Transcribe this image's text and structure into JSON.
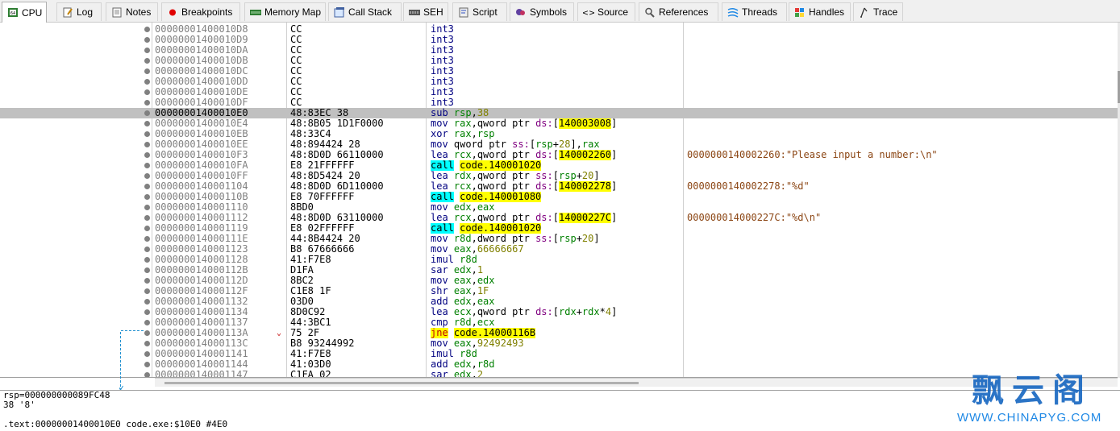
{
  "tabs": [
    {
      "label": "CPU",
      "icon": "cpu-icon"
    },
    {
      "label": "Log",
      "icon": "log-icon"
    },
    {
      "label": "Notes",
      "icon": "notes-icon"
    },
    {
      "label": "Breakpoints",
      "icon": "breakpoint-icon"
    },
    {
      "label": "Memory Map",
      "icon": "memory-map-icon"
    },
    {
      "label": "Call Stack",
      "icon": "call-stack-icon"
    },
    {
      "label": "SEH",
      "icon": "seh-icon"
    },
    {
      "label": "Script",
      "icon": "script-icon"
    },
    {
      "label": "Symbols",
      "icon": "symbols-icon"
    },
    {
      "label": "Source",
      "icon": "source-icon"
    },
    {
      "label": "References",
      "icon": "references-icon"
    },
    {
      "label": "Threads",
      "icon": "threads-icon"
    },
    {
      "label": "Handles",
      "icon": "handles-icon"
    },
    {
      "label": "Trace",
      "icon": "trace-icon"
    }
  ],
  "active_tab": "CPU",
  "disasm": {
    "selected_address": "00000001400010E0",
    "rows": [
      {
        "addr": "00000001400010D8",
        "bytes": "CC",
        "instr": [
          [
            "k",
            "int3"
          ]
        ],
        "comment": ""
      },
      {
        "addr": "00000001400010D9",
        "bytes": "CC",
        "instr": [
          [
            "k",
            "int3"
          ]
        ],
        "comment": ""
      },
      {
        "addr": "00000001400010DA",
        "bytes": "CC",
        "instr": [
          [
            "k",
            "int3"
          ]
        ],
        "comment": ""
      },
      {
        "addr": "00000001400010DB",
        "bytes": "CC",
        "instr": [
          [
            "k",
            "int3"
          ]
        ],
        "comment": ""
      },
      {
        "addr": "00000001400010DC",
        "bytes": "CC",
        "instr": [
          [
            "k",
            "int3"
          ]
        ],
        "comment": ""
      },
      {
        "addr": "00000001400010DD",
        "bytes": "CC",
        "instr": [
          [
            "k",
            "int3"
          ]
        ],
        "comment": ""
      },
      {
        "addr": "00000001400010DE",
        "bytes": "CC",
        "instr": [
          [
            "k",
            "int3"
          ]
        ],
        "comment": ""
      },
      {
        "addr": "00000001400010DF",
        "bytes": "CC",
        "instr": [
          [
            "k",
            "int3"
          ]
        ],
        "comment": ""
      },
      {
        "addr": "00000001400010E0",
        "bytes": "48:83EC 38",
        "instr": [
          [
            "k",
            "sub "
          ],
          [
            "reg",
            "rsp"
          ],
          [
            "pt",
            ","
          ],
          [
            "num",
            "38"
          ]
        ],
        "comment": ""
      },
      {
        "addr": "00000001400010E4",
        "bytes": "48:8B05 1D1F0000",
        "instr": [
          [
            "k",
            "mov "
          ],
          [
            "reg",
            "rax"
          ],
          [
            "pt",
            ",qword ptr "
          ],
          [
            "seg",
            "ds:"
          ],
          [
            "pt",
            "["
          ],
          [
            "hl",
            "140003008"
          ],
          [
            "pt",
            "]"
          ]
        ],
        "comment": ""
      },
      {
        "addr": "00000001400010EB",
        "bytes": "48:33C4",
        "instr": [
          [
            "k",
            "xor "
          ],
          [
            "reg",
            "rax"
          ],
          [
            "pt",
            ","
          ],
          [
            "reg",
            "rsp"
          ]
        ],
        "comment": ""
      },
      {
        "addr": "00000001400010EE",
        "bytes": "48:894424 28",
        "instr": [
          [
            "k",
            "mov "
          ],
          [
            "pt",
            "qword ptr "
          ],
          [
            "seg",
            "ss:"
          ],
          [
            "pt",
            "["
          ],
          [
            "reg",
            "rsp"
          ],
          [
            "pt",
            "+"
          ],
          [
            "num",
            "28"
          ],
          [
            "pt",
            "],"
          ],
          [
            "reg",
            "rax"
          ]
        ],
        "comment": ""
      },
      {
        "addr": "00000001400010F3",
        "bytes": "48:8D0D 66110000",
        "instr": [
          [
            "k",
            "lea "
          ],
          [
            "reg",
            "rcx"
          ],
          [
            "pt",
            ",qword ptr "
          ],
          [
            "seg",
            "ds:"
          ],
          [
            "pt",
            "["
          ],
          [
            "hl",
            "140002260"
          ],
          [
            "pt",
            "]"
          ]
        ],
        "comment": "0000000140002260:\"Please input a number:\\n\""
      },
      {
        "addr": "00000001400010FA",
        "bytes": "E8 21FFFFFF",
        "instr": [
          [
            "call",
            "call"
          ],
          [
            "pt",
            " "
          ],
          [
            "tgt",
            "code.140001020"
          ]
        ],
        "comment": ""
      },
      {
        "addr": "00000001400010FF",
        "bytes": "48:8D5424 20",
        "instr": [
          [
            "k",
            "lea "
          ],
          [
            "reg",
            "rdx"
          ],
          [
            "pt",
            ",qword ptr "
          ],
          [
            "seg",
            "ss:"
          ],
          [
            "pt",
            "["
          ],
          [
            "reg",
            "rsp"
          ],
          [
            "pt",
            "+"
          ],
          [
            "num",
            "20"
          ],
          [
            "pt",
            "]"
          ]
        ],
        "comment": ""
      },
      {
        "addr": "0000000140001104",
        "bytes": "48:8D0D 6D110000",
        "instr": [
          [
            "k",
            "lea "
          ],
          [
            "reg",
            "rcx"
          ],
          [
            "pt",
            ",qword ptr "
          ],
          [
            "seg",
            "ds:"
          ],
          [
            "pt",
            "["
          ],
          [
            "hl",
            "140002278"
          ],
          [
            "pt",
            "]"
          ]
        ],
        "comment": "0000000140002278:\"%d\""
      },
      {
        "addr": "000000014000110B",
        "bytes": "E8 70FFFFFF",
        "instr": [
          [
            "call",
            "call"
          ],
          [
            "pt",
            " "
          ],
          [
            "tgt",
            "code.140001080"
          ]
        ],
        "comment": ""
      },
      {
        "addr": "0000000140001110",
        "bytes": "8BD0",
        "instr": [
          [
            "k",
            "mov "
          ],
          [
            "reg",
            "edx"
          ],
          [
            "pt",
            ","
          ],
          [
            "reg",
            "eax"
          ]
        ],
        "comment": ""
      },
      {
        "addr": "0000000140001112",
        "bytes": "48:8D0D 63110000",
        "instr": [
          [
            "k",
            "lea "
          ],
          [
            "reg",
            "rcx"
          ],
          [
            "pt",
            ",qword ptr "
          ],
          [
            "seg",
            "ds:"
          ],
          [
            "pt",
            "["
          ],
          [
            "hl",
            "14000227C"
          ],
          [
            "pt",
            "]"
          ]
        ],
        "comment": "000000014000227C:\"%d\\n\""
      },
      {
        "addr": "0000000140001119",
        "bytes": "E8 02FFFFFF",
        "instr": [
          [
            "call",
            "call"
          ],
          [
            "pt",
            " "
          ],
          [
            "tgt",
            "code.140001020"
          ]
        ],
        "comment": ""
      },
      {
        "addr": "000000014000111E",
        "bytes": "44:8B4424 20",
        "instr": [
          [
            "k",
            "mov "
          ],
          [
            "reg",
            "r8d"
          ],
          [
            "pt",
            ",dword ptr "
          ],
          [
            "seg",
            "ss:"
          ],
          [
            "pt",
            "["
          ],
          [
            "reg",
            "rsp"
          ],
          [
            "pt",
            "+"
          ],
          [
            "num",
            "20"
          ],
          [
            "pt",
            "]"
          ]
        ],
        "comment": ""
      },
      {
        "addr": "0000000140001123",
        "bytes": "B8 67666666",
        "instr": [
          [
            "k",
            "mov "
          ],
          [
            "reg",
            "eax"
          ],
          [
            "pt",
            ","
          ],
          [
            "num",
            "66666667"
          ]
        ],
        "comment": ""
      },
      {
        "addr": "0000000140001128",
        "bytes": "41:F7E8",
        "instr": [
          [
            "k",
            "imul "
          ],
          [
            "reg",
            "r8d"
          ]
        ],
        "comment": ""
      },
      {
        "addr": "000000014000112B",
        "bytes": "D1FA",
        "instr": [
          [
            "k",
            "sar "
          ],
          [
            "reg",
            "edx"
          ],
          [
            "pt",
            ","
          ],
          [
            "num",
            "1"
          ]
        ],
        "comment": ""
      },
      {
        "addr": "000000014000112D",
        "bytes": "8BC2",
        "instr": [
          [
            "k",
            "mov "
          ],
          [
            "reg",
            "eax"
          ],
          [
            "pt",
            ","
          ],
          [
            "reg",
            "edx"
          ]
        ],
        "comment": ""
      },
      {
        "addr": "000000014000112F",
        "bytes": "C1E8 1F",
        "instr": [
          [
            "k",
            "shr "
          ],
          [
            "reg",
            "eax"
          ],
          [
            "pt",
            ","
          ],
          [
            "num",
            "1F"
          ]
        ],
        "comment": ""
      },
      {
        "addr": "0000000140001132",
        "bytes": "03D0",
        "instr": [
          [
            "k",
            "add "
          ],
          [
            "reg",
            "edx"
          ],
          [
            "pt",
            ","
          ],
          [
            "reg",
            "eax"
          ]
        ],
        "comment": ""
      },
      {
        "addr": "0000000140001134",
        "bytes": "8D0C92",
        "instr": [
          [
            "k",
            "lea "
          ],
          [
            "reg",
            "ecx"
          ],
          [
            "pt",
            ",qword ptr "
          ],
          [
            "seg",
            "ds:"
          ],
          [
            "pt",
            "["
          ],
          [
            "reg",
            "rdx"
          ],
          [
            "pt",
            "+"
          ],
          [
            "reg",
            "rdx"
          ],
          [
            "pt",
            "*"
          ],
          [
            "num",
            "4"
          ],
          [
            "pt",
            "]"
          ]
        ],
        "comment": ""
      },
      {
        "addr": "0000000140001137",
        "bytes": "44:3BC1",
        "instr": [
          [
            "k",
            "cmp "
          ],
          [
            "reg",
            "r8d"
          ],
          [
            "pt",
            ","
          ],
          [
            "reg",
            "ecx"
          ]
        ],
        "comment": ""
      },
      {
        "addr": "000000014000113A",
        "bytes": "75 2F",
        "instr": [
          [
            "jmp",
            "jne"
          ],
          [
            "pt",
            " "
          ],
          [
            "tgt",
            "code.14000116B"
          ]
        ],
        "comment": "",
        "arrow": "⌄"
      },
      {
        "addr": "000000014000113C",
        "bytes": "B8 93244992",
        "instr": [
          [
            "k",
            "mov "
          ],
          [
            "reg",
            "eax"
          ],
          [
            "pt",
            ","
          ],
          [
            "num",
            "92492493"
          ]
        ],
        "comment": ""
      },
      {
        "addr": "0000000140001141",
        "bytes": "41:F7E8",
        "instr": [
          [
            "k",
            "imul "
          ],
          [
            "reg",
            "r8d"
          ]
        ],
        "comment": ""
      },
      {
        "addr": "0000000140001144",
        "bytes": "41:03D0",
        "instr": [
          [
            "k",
            "add "
          ],
          [
            "reg",
            "edx"
          ],
          [
            "pt",
            ","
          ],
          [
            "reg",
            "r8d"
          ]
        ],
        "comment": ""
      },
      {
        "addr": "0000000140001147",
        "bytes": "C1FA 02",
        "instr": [
          [
            "k",
            "sar "
          ],
          [
            "reg",
            "edx"
          ],
          [
            "pt",
            ","
          ],
          [
            "num",
            "2"
          ]
        ],
        "comment": ""
      }
    ]
  },
  "info": {
    "line1": "rsp=000000000089FC48",
    "line2": "38 '8'",
    "line3": "",
    "line4": ".text:00000001400010E0 code.exe:$10E0 #4E0"
  },
  "watermark": {
    "cn": "飘云阁",
    "url": "WWW.CHINAPYG.COM"
  },
  "colors": {
    "selected_row": "#c0c0c0",
    "call_highlight": "#00ffff",
    "jump_highlight": "#ffff00",
    "address_highlight": "#ffff00",
    "comment": "#8b4513",
    "register": "#008000",
    "number": "#808000",
    "segment": "#800080",
    "watermark": "#1565c0"
  }
}
